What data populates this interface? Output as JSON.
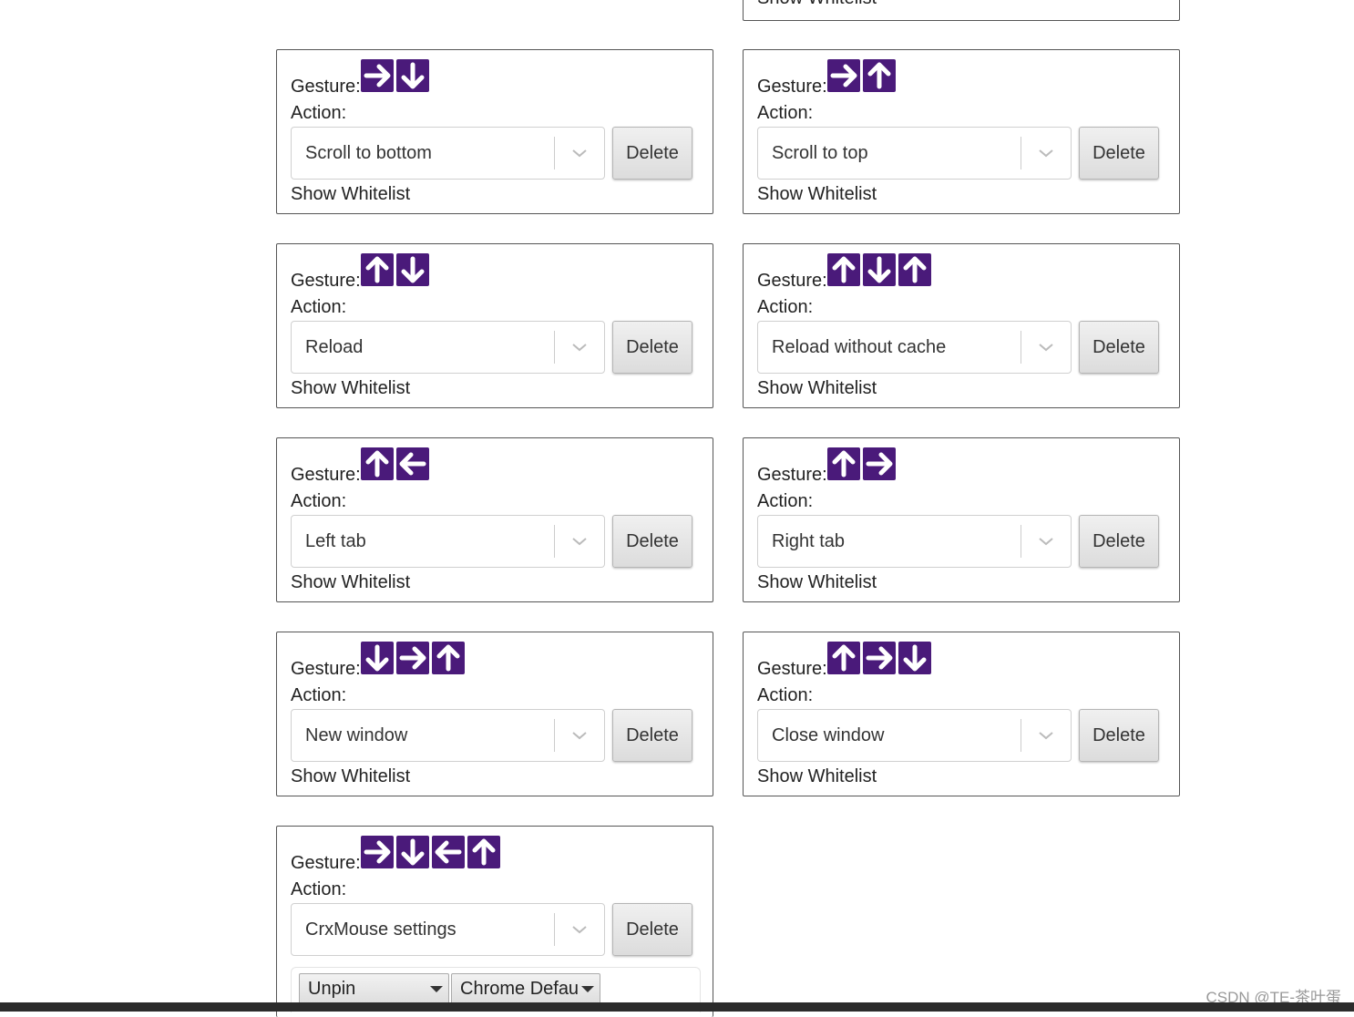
{
  "labels": {
    "gesture": "Gesture:",
    "action": "Action:",
    "show_whitelist": "Show Whitelist",
    "delete": "Delete"
  },
  "colors": {
    "arrow_tile": "#4a1a7a",
    "arrow_glyph": "#ffffff"
  },
  "gestures": [
    {
      "arrows": [
        "right",
        "down"
      ],
      "action": "Scroll to bottom"
    },
    {
      "arrows": [
        "right",
        "up"
      ],
      "action": "Scroll to top"
    },
    {
      "arrows": [
        "up",
        "down"
      ],
      "action": "Reload"
    },
    {
      "arrows": [
        "up",
        "down",
        "up"
      ],
      "action": "Reload without cache"
    },
    {
      "arrows": [
        "up",
        "left"
      ],
      "action": "Left tab"
    },
    {
      "arrows": [
        "up",
        "right"
      ],
      "action": "Right tab"
    },
    {
      "arrows": [
        "down",
        "right",
        "up"
      ],
      "action": "New window"
    },
    {
      "arrows": [
        "up",
        "right",
        "down"
      ],
      "action": "Close window"
    },
    {
      "arrows": [
        "right",
        "down",
        "left",
        "up"
      ],
      "action": "CrxMouse settings"
    }
  ],
  "last_card_options": {
    "pin_select": "Unpin",
    "browser_select": "Chrome Defau"
  },
  "watermark": "CSDN @TE-茶叶蛋"
}
